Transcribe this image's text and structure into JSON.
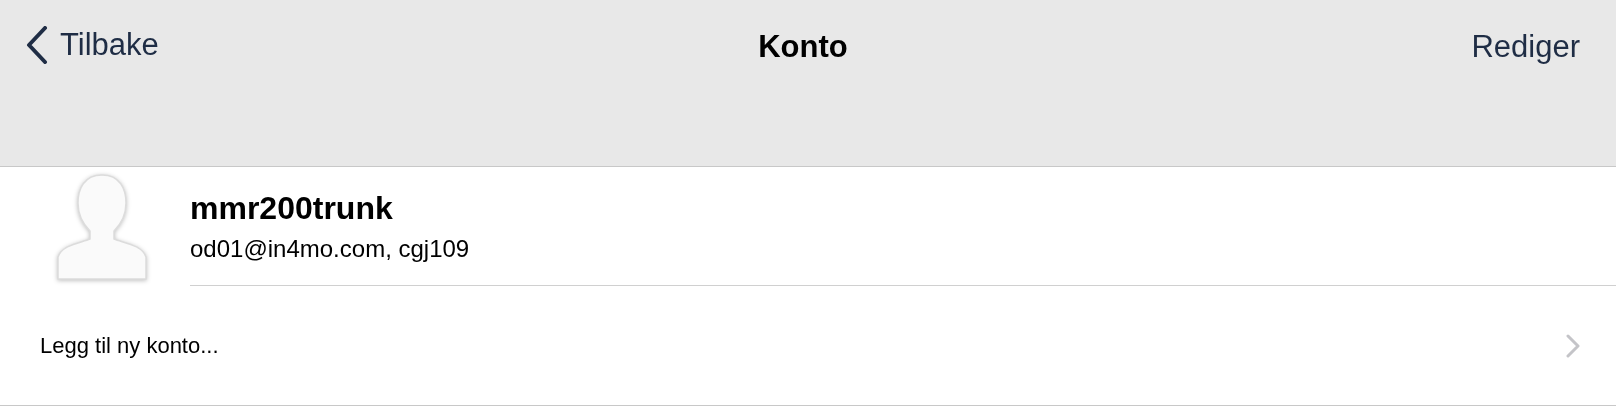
{
  "nav_bar": {
    "back_label": "Tilbake",
    "title": "Konto",
    "action": "Rediger"
  },
  "account": {
    "name": "mmr200trunk",
    "details": "od01@in4mo.com, cgj109"
  },
  "add_account": {
    "label": "Legg til ny konto..."
  }
}
